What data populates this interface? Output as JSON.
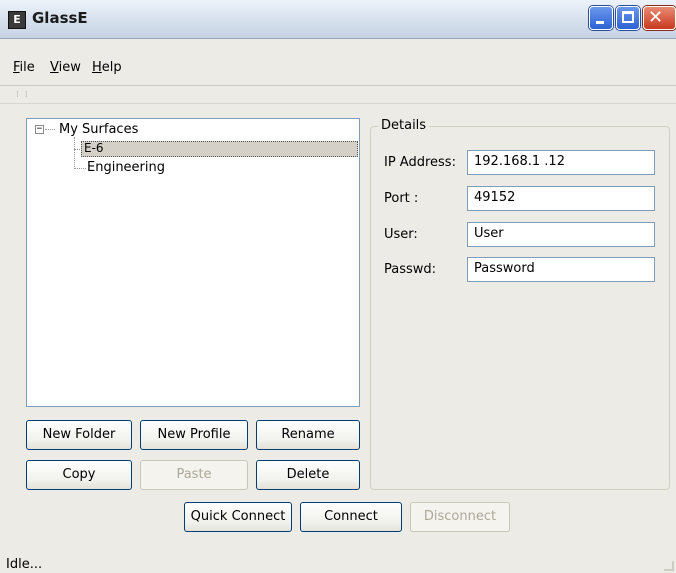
{
  "window": {
    "title": "GlassE",
    "icon_letter": "E"
  },
  "menu": [
    {
      "label": "File",
      "mnemonic": "F",
      "rest": "ile"
    },
    {
      "label": "View",
      "mnemonic": "V",
      "rest": "iew"
    },
    {
      "label": "Help",
      "mnemonic": "H",
      "rest": "elp"
    }
  ],
  "tree": {
    "root": "My Surfaces",
    "expander": "−",
    "items": [
      {
        "label": "E-6",
        "selected": true
      },
      {
        "label": "Engineering",
        "selected": false
      }
    ]
  },
  "buttons": {
    "new_folder": "New Folder",
    "new_profile": "New Profile",
    "rename": "Rename",
    "copy": "Copy",
    "paste": "Paste",
    "delete": "Delete",
    "quick_connect": "Quick Connect",
    "connect": "Connect",
    "disconnect": "Disconnect"
  },
  "details": {
    "title": "Details",
    "ip_label": "IP Address:",
    "ip_value": "192.168.1 .12",
    "port_label": "Port :",
    "port_value": "49152",
    "user_label": "User:",
    "user_value": "User",
    "passwd_label": "Passwd:",
    "passwd_value": "Password"
  },
  "status": {
    "text": "Idle..."
  }
}
